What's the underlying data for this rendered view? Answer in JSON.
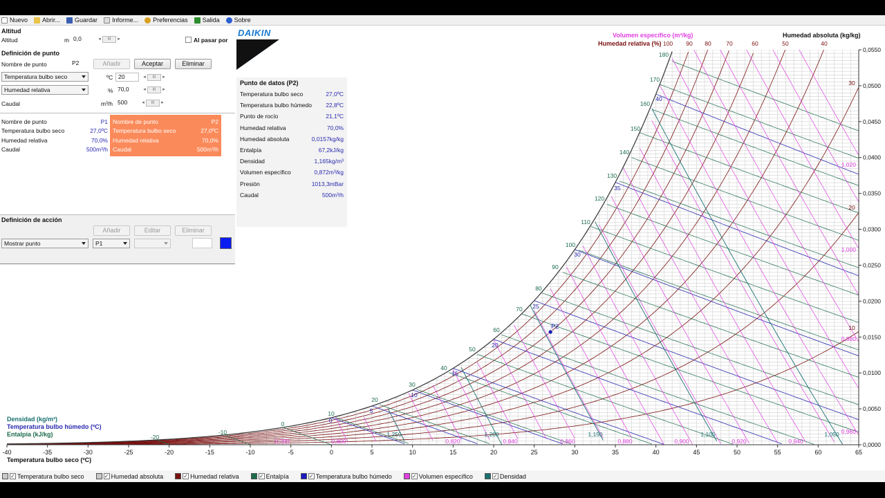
{
  "menu": [
    "Nuevo",
    "Abrir...",
    "Guardar",
    "Informe...",
    "Preferencias",
    "Salida",
    "Sobre"
  ],
  "altitud": {
    "title": "Altitud",
    "label": "Altitud",
    "unit": "m",
    "value": "0,0",
    "checkbox_label": "Al pasar por"
  },
  "definicion_punto": {
    "title": "Definición de punto",
    "name_label": "Nombre de punto",
    "name_value": "P2",
    "btn_add": "Añadir",
    "btn_accept": "Aceptar",
    "btn_delete": "Eliminar",
    "param1": "Temperatura bulbo seco",
    "param1_unit": "ºC",
    "param1_value": "20",
    "param2": "Humedad relativa",
    "param2_unit": "%",
    "param2_value": "70,0",
    "caudal_label": "Caudal",
    "caudal_unit": "m³/h",
    "caudal_value": "500"
  },
  "points": [
    {
      "rows": [
        [
          "Nombre de punto",
          "P1"
        ],
        [
          "Temperatura bulbo seco",
          "27,0ºC"
        ],
        [
          "Humedad relativa",
          "70,0%"
        ],
        [
          "Caudal",
          "500m³/h"
        ]
      ]
    },
    {
      "rows": [
        [
          "Nombre de punto",
          "P2"
        ],
        [
          "Temperatura bulbo seco",
          "27,0ºC"
        ],
        [
          "Humedad relativa",
          "70,0%"
        ],
        [
          "Caudal",
          "500m³/h"
        ]
      ]
    }
  ],
  "definicion_accion": {
    "title": "Definición de acción",
    "btn_add": "Añadir",
    "btn_edit": "Editar",
    "btn_delete": "Eliminar",
    "action_select": "Mostrar punto",
    "point_select": "P1",
    "color": "#0a1cf0"
  },
  "punto_datos": {
    "title": "Punto de datos (P2)",
    "rows": [
      [
        "Temperatura bulbo seco",
        "27,0ºC"
      ],
      [
        "Temperatura bulbo húmedo",
        "22,8ºC"
      ],
      [
        "Punto de rocío",
        "21,1ºC"
      ],
      [
        "Humedad relativa",
        "70,0%"
      ],
      [
        "Humedad absoluta",
        "0,0157kg/kg"
      ],
      [
        "Entalpía",
        "67,2kJ/kg"
      ],
      [
        "Densidad",
        "1,165kg/m³"
      ],
      [
        "Volumen específico",
        "0,872m³/kg"
      ],
      [
        "Presión",
        "1013,3mBar"
      ],
      [
        "Caudal",
        "500m³/h"
      ]
    ]
  },
  "logo": "DAIKIN",
  "chart_labels": {
    "xlabel": "Temperatura bulbo seco (ºC)",
    "densidad": "Densidad (kg/m³)",
    "bulbo_humedo": "Temperatura bulbo húmedo (ºC)",
    "entalpia": "Entalpía (kJ/kg)",
    "vol_especifico": "Volumen específico (m³/kg)",
    "hum_relativa": "Humedad relativa (%)",
    "hum_absoluta": "Humedad absoluta (kg/kg)",
    "point_label": "P2"
  },
  "chart_data": {
    "type": "scatter",
    "x_ticks": [
      -40,
      -35,
      -30,
      -25,
      -20,
      -15,
      -10,
      -5,
      0,
      5,
      10,
      15,
      20,
      25,
      30,
      35,
      40,
      45,
      50,
      55,
      60,
      65
    ],
    "y_ticks": [
      "0,0000",
      "0,0050",
      "0,0100",
      "0,0150",
      "0,0200",
      "0,0250",
      "0,0300",
      "0,0350",
      "0,0400",
      "0,0450",
      "0,0500",
      "0,0550"
    ],
    "xlim": [
      -40,
      65
    ],
    "ylim": [
      0,
      0.055
    ],
    "rh_top_labels": [
      "100",
      "90",
      "80",
      "70",
      "60",
      "50",
      "40"
    ],
    "rh_right_labels": [
      "30",
      "20",
      "10"
    ],
    "vol_right_labels": [
      "1,020",
      "1,000",
      "0,980",
      "0,960"
    ],
    "vol_bottom_labels": [
      "0,780",
      "0,800",
      "0,820",
      "0,840",
      "0,860",
      "0,880",
      "0,900",
      "0,920",
      "0,940"
    ],
    "density_bottom_labels": [
      "1,250",
      "1,200",
      "1,150",
      "1,100",
      "1,050"
    ],
    "wetbulb_labels": [
      "40",
      "35",
      "30",
      "25",
      "20",
      "15",
      "10",
      "5",
      "0"
    ],
    "enthalpy_labels": [
      "180",
      "170",
      "160",
      "150",
      "140",
      "130",
      "120",
      "110",
      "100",
      "90",
      "80",
      "70",
      "60",
      "50",
      "40",
      "30",
      "20",
      "10",
      "0",
      "-10",
      "-20"
    ],
    "point": {
      "name": "P2",
      "x": 27.0,
      "y": 0.0157
    }
  },
  "legend": [
    {
      "label": "Temperatura bulbo seco",
      "color": "#c8c8c8"
    },
    {
      "label": "Humedad absoluta",
      "color": "#c8c8c8"
    },
    {
      "label": "Humedad relativa",
      "color": "#7a1010"
    },
    {
      "label": "Entalpía",
      "color": "#1a6b4a"
    },
    {
      "label": "Temperatura bulbo húmedo",
      "color": "#1a1ac0"
    },
    {
      "label": "Volumen específico",
      "color": "#e040e0"
    },
    {
      "label": "Densidad",
      "color": "#1a7070"
    }
  ]
}
